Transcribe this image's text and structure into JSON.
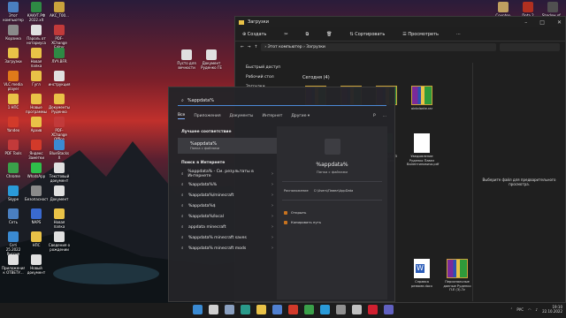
{
  "desktop_icons": [
    {
      "label": "Этот компьютер",
      "color": "#4a7fc0"
    },
    {
      "label": "КАКУТ.РФ 2022.xlt",
      "color": "#2e8a44"
    },
    {
      "label": "АКС_Т00...",
      "color": "#c9a23c"
    },
    {
      "label": "Корзина",
      "color": "#8a8a8a"
    },
    {
      "label": "Пароль от нотариуса",
      "color": "#e0e0e0"
    },
    {
      "label": "PDF-XChange Editor",
      "color": "#c23a3a"
    },
    {
      "label": "Загрузки",
      "color": "#e9c247"
    },
    {
      "label": "Новая папка",
      "color": "#e9c247"
    },
    {
      "label": "ЛУЧ.BFR",
      "color": "#2e8a44"
    },
    {
      "label": "VLC media player",
      "color": "#e07a1a"
    },
    {
      "label": "Гугл",
      "color": "#e9c247"
    },
    {
      "label": "инструкция",
      "color": "#e0e0e0"
    },
    {
      "label": "1 НПС",
      "color": "#e9c247"
    },
    {
      "label": "Новые программы",
      "color": "#e9c247"
    },
    {
      "label": "Документы Руденко",
      "color": "#e9c247"
    },
    {
      "label": "Yandex",
      "color": "#d23a2a"
    },
    {
      "label": "Архив",
      "color": "#e9c247"
    },
    {
      "label": "PDF-XChange Office",
      "color": "#c23a3a"
    },
    {
      "label": "PDF Tools",
      "color": "#c23a3a"
    },
    {
      "label": "Яндекс Заметки",
      "color": "#d23a2a"
    },
    {
      "label": "BlueStacks X",
      "color": "#3a8ad2"
    },
    {
      "label": "Chrome",
      "color": "#3aa04a"
    },
    {
      "label": "WhatsApp",
      "color": "#2fbf4a"
    },
    {
      "label": "Текстовый документ",
      "color": "#e0e0e0"
    },
    {
      "label": "Skype",
      "color": "#2a9ad8"
    },
    {
      "label": "Безопасность",
      "color": "#8a8a8a"
    },
    {
      "label": "Документ",
      "color": "#e0e0e0"
    },
    {
      "label": "Сеть",
      "color": "#4a7fc0"
    },
    {
      "label": "NAPS",
      "color": "#3a6ad0"
    },
    {
      "label": "Новая папка",
      "color": "#e9c247"
    },
    {
      "label": "Сеті 25.2022 Руссия",
      "color": "#3a8ad2"
    },
    {
      "label": "НПС",
      "color": "#e9c247"
    },
    {
      "label": "Сведения о рождении",
      "color": "#e0e0e0"
    },
    {
      "label": "Приложения к ОТВЕТУ...",
      "color": "#e0e0e0"
    },
    {
      "label": "Новый документ",
      "color": "#e0e0e0"
    }
  ],
  "desktop_icons_right": [
    {
      "label": "Counter-Str...",
      "color": "#c0a060"
    },
    {
      "label": "Dota 2",
      "color": "#b03020"
    },
    {
      "label": "Shadow of...",
      "color": "#505050"
    }
  ],
  "desktop_mid_icons": [
    {
      "label": "Пусто для вечности",
      "color": "#e0e0e0"
    },
    {
      "label": "Документ Руденко ГЕ",
      "color": "#e0e0e0"
    }
  ],
  "explorer": {
    "title": "Загрузки",
    "toolbar": [
      "Создать",
      "Сортировать",
      "Просмотреть"
    ],
    "address": "› Этот компьютер › Загрузки",
    "nav": [
      "Быстрый доступ",
      "Рабочий стол",
      "Загрузки"
    ],
    "group": "Сегодня (4)",
    "files": [
      {
        "name": "",
        "type": "rar"
      },
      {
        "name": "",
        "type": "rar"
      },
      {
        "name": "",
        "type": "rar"
      },
      {
        "name": "ainkdante.rar",
        "type": "rar"
      },
      {
        "name": "Полисы СОГАЗ Тюмень.xls",
        "type": "xls"
      },
      {
        "name": "Уведомление Руденко Павел Валентиновича.pdf",
        "type": "pdf"
      },
      {
        "name": "Справка резюме.docx",
        "type": "docx"
      },
      {
        "name": "Персональные данные Руденко П.Е (3).7z",
        "type": "rar"
      }
    ],
    "preview_text": "Выберите файл для предварительного просмотра."
  },
  "search": {
    "query": "%appdata%",
    "tabs": [
      "Все",
      "Приложения",
      "Документы",
      "Интернет",
      "Другие ▾"
    ],
    "extra": [
      "P",
      "..."
    ],
    "best_match_header": "Лучшее соответствие",
    "best_match": {
      "title": "%appdata%",
      "subtitle": "Папка с файлами"
    },
    "web_header": "Поиск в Интернете",
    "web_results": [
      "%appdata% - См. результаты в Интернете",
      "%appdata%%",
      "%appdata%/minecraft",
      "%appdata%$",
      "%appdata%/local",
      "appdata minecraft",
      "%appdata% minecraft saves",
      "%appdata% minecraft mods"
    ],
    "preview": {
      "title": "%appdata%",
      "subtitle": "Папка с файлами",
      "location_label": "Расположение",
      "location_value": "C:\\Users\\Павел\\AppData",
      "actions": [
        "Открыть",
        "Копировать путь"
      ]
    }
  },
  "taskbar": {
    "apps": [
      {
        "name": "start",
        "color": "#3a8ad2"
      },
      {
        "name": "search",
        "color": "#d0d0d0"
      },
      {
        "name": "taskview",
        "color": "#8aa0c0"
      },
      {
        "name": "edge",
        "color": "#2a9a8a"
      },
      {
        "name": "explorer",
        "color": "#e9c247"
      },
      {
        "name": "store",
        "color": "#5080d0"
      },
      {
        "name": "yandex",
        "color": "#d23a2a"
      },
      {
        "name": "chrome",
        "color": "#3aa04a"
      },
      {
        "name": "telegram",
        "color": "#2a9ad8"
      },
      {
        "name": "settings",
        "color": "#909090"
      },
      {
        "name": "app",
        "color": "#c0c0c0"
      },
      {
        "name": "opera",
        "color": "#d02030"
      },
      {
        "name": "app2",
        "color": "#6060c0"
      }
    ],
    "tray_lang": "РУС",
    "time": "19:10",
    "date": "22.10.2022"
  }
}
